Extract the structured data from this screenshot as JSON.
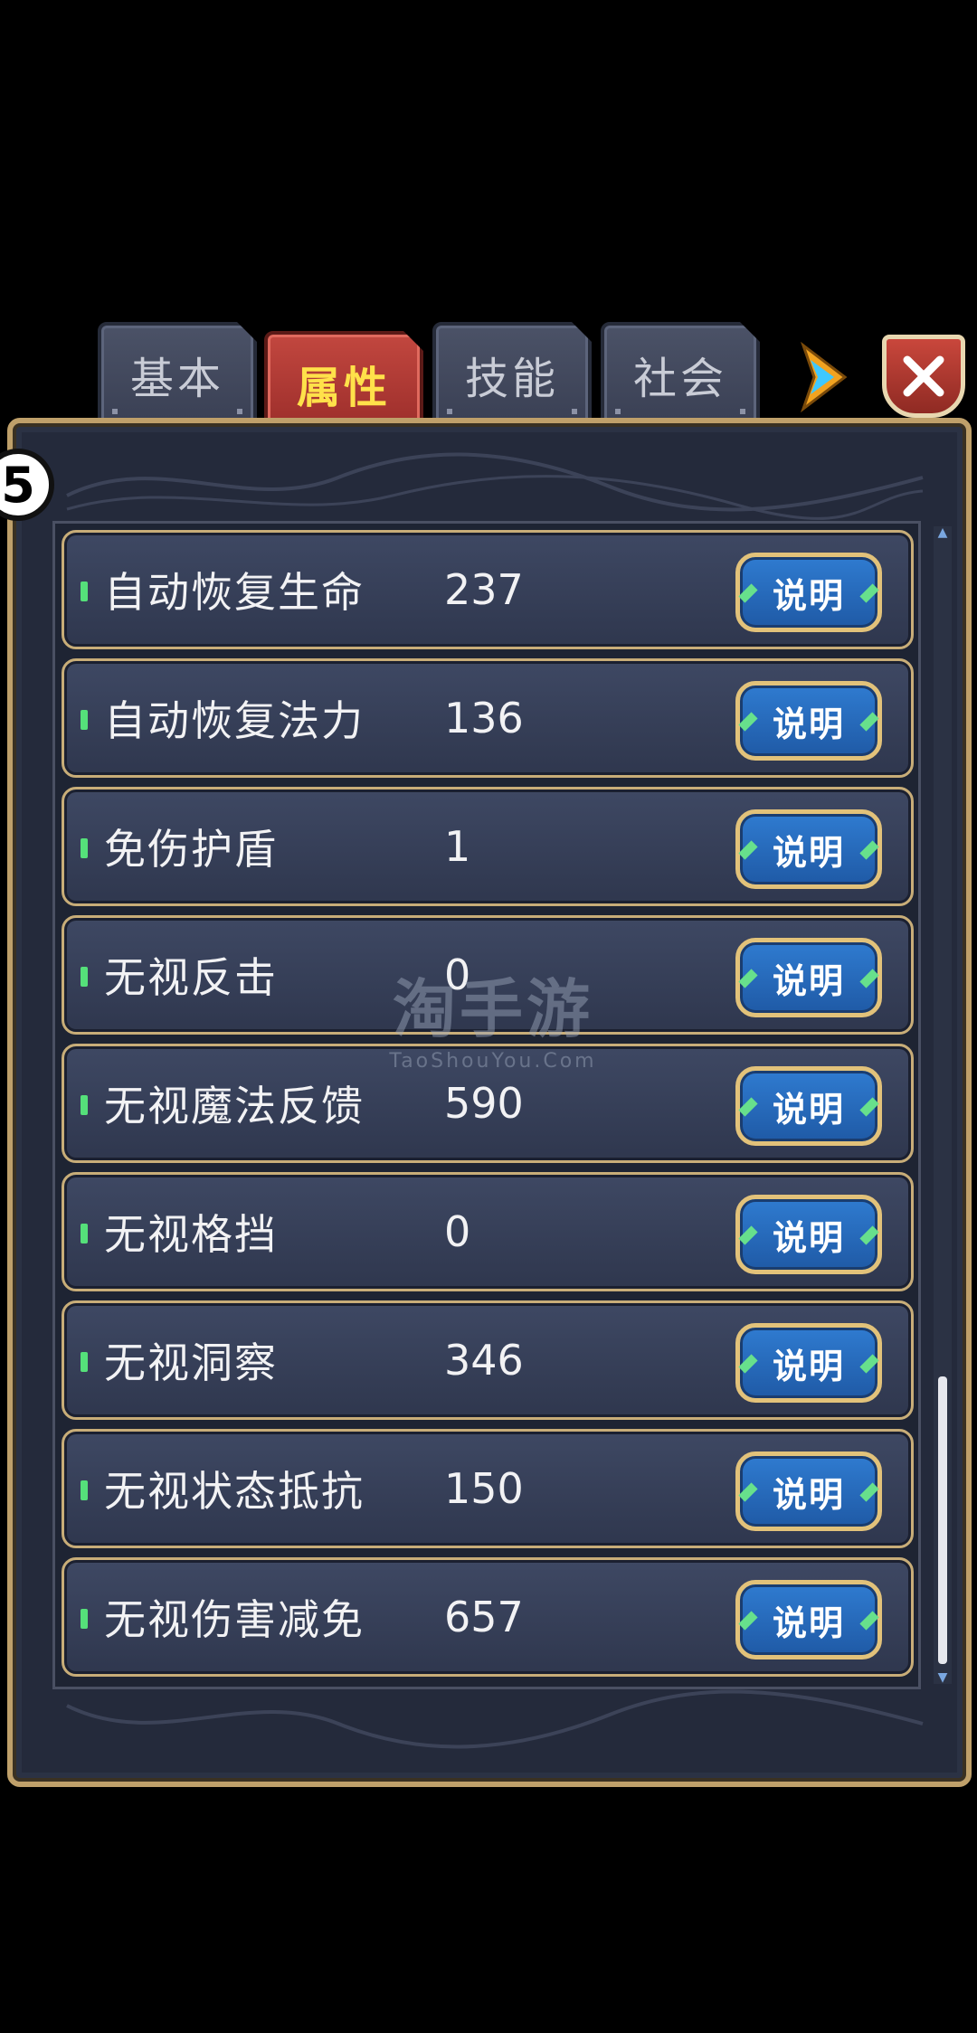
{
  "tabs": [
    {
      "label": "基本",
      "active": false
    },
    {
      "label": "属性",
      "active": true
    },
    {
      "label": "技能",
      "active": false
    },
    {
      "label": "社会",
      "active": false
    }
  ],
  "badge": "5",
  "watermark": {
    "main": "淘手游",
    "sub": "TaoShouYou.Com"
  },
  "info_button_label": "说明",
  "attributes": [
    {
      "name": "自动恢复生命",
      "value": "237"
    },
    {
      "name": "自动恢复法力",
      "value": "136"
    },
    {
      "name": "免伤护盾",
      "value": "1"
    },
    {
      "name": "无视反击",
      "value": "0"
    },
    {
      "name": "无视魔法反馈",
      "value": "590"
    },
    {
      "name": "无视格挡",
      "value": "0"
    },
    {
      "name": "无视洞察",
      "value": "346"
    },
    {
      "name": "无视状态抵抗",
      "value": "150"
    },
    {
      "name": "无视伤害减免",
      "value": "657"
    }
  ],
  "icons": {
    "next": "arrow-right-icon",
    "close": "close-icon"
  },
  "colors": {
    "active_tab": "#b8413a",
    "active_tab_text": "#ffe14a",
    "frame_gold": "#c8ad78",
    "info_button": "#2a6cc2",
    "marker": "#55e07a"
  }
}
